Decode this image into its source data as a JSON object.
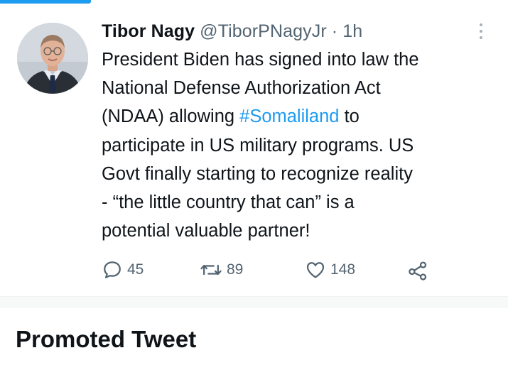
{
  "tweet": {
    "author_name": "Tibor Nagy",
    "handle": "@TiborPNagyJr",
    "separator": "·",
    "time": "1h",
    "text_lines": [
      "President Biden has signed into law the",
      "National Defense Authorization Act",
      "(NDAA) allowing ",
      "participate in US military programs. US",
      "Govt finally starting to recognize reality",
      "- “the little country that can” is  a",
      "potential valuable partner!"
    ],
    "hashtag": "#Somaliland",
    "after_hashtag": " to",
    "replies": "45",
    "retweets": "89",
    "likes": "148"
  },
  "section": {
    "promoted_label": "Promoted Tweet"
  },
  "colors": {
    "accent": "#1d9bf0",
    "secondary_text": "#536471",
    "primary_text": "#0f1419"
  },
  "icons": [
    "avatar-photo",
    "more-dots-icon",
    "reply-icon",
    "retweet-icon",
    "like-icon",
    "share-icon"
  ]
}
